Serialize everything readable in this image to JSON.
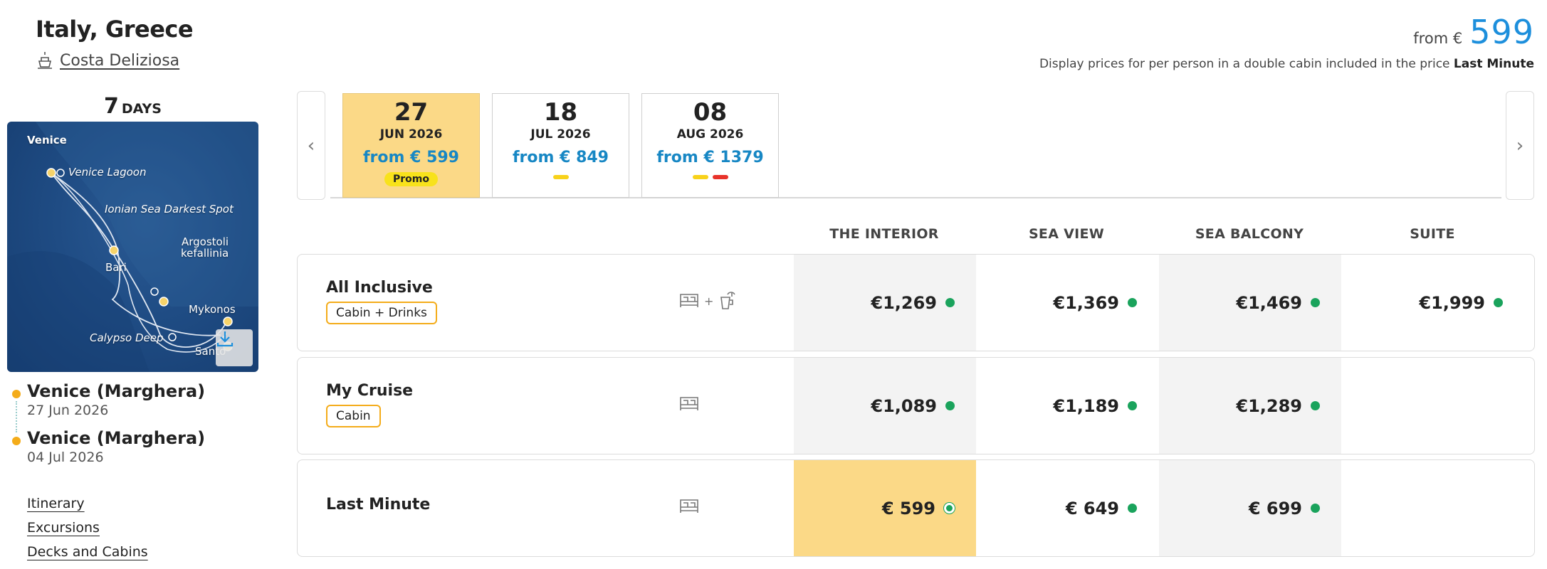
{
  "header": {
    "title": "Italy, Greece",
    "ship": "Costa Deliziosa",
    "from_label": "from €",
    "from_value": "599",
    "disclaimer_text": "Display prices for per person in a double cabin included in the price",
    "disclaimer_bold": "Last Minute"
  },
  "trip": {
    "days_number": "7",
    "days_unit": "DAYS",
    "map_labels": {
      "venice": "Venice",
      "venice_lagoon": "Venice Lagoon",
      "ionian": "Ionian Sea Darkest Spot",
      "argostoli": "Argostoli",
      "kefallinia": "kefallinia",
      "bari": "Bari",
      "mykonos": "Mykonos",
      "calypso": "Calypso Deep",
      "santorini": "Santo"
    },
    "ports": [
      {
        "name": "Venice (Marghera)",
        "date": "27 Jun 2026"
      },
      {
        "name": "Venice (Marghera)",
        "date": "04 Jul 2026"
      }
    ],
    "links": [
      "Itinerary",
      "Excursions",
      "Decks and Cabins"
    ]
  },
  "dates": [
    {
      "day": "27",
      "month": "JUN 2026",
      "price": "from € 599",
      "promo": "Promo",
      "selected": true
    },
    {
      "day": "18",
      "month": "JUL 2026",
      "price": "from € 849",
      "bars": [
        "#f8d21b"
      ]
    },
    {
      "day": "08",
      "month": "AUG 2026",
      "price": "from € 1379",
      "bars": [
        "#f8d21b",
        "#e8332a"
      ]
    }
  ],
  "cabin_headers": [
    "THE INTERIOR",
    "SEA VIEW",
    "SEA BALCONY",
    "SUITE"
  ],
  "fares": [
    {
      "name": "All Inclusive",
      "tag": "Cabin + Drinks",
      "icons": "bed + drinks",
      "plus": "+",
      "prices": [
        "€1,269",
        "€1,369",
        "€1,469",
        "€1,999"
      ]
    },
    {
      "name": "My Cruise",
      "tag": "Cabin",
      "icons": "bed",
      "prices": [
        "€1,089",
        "€1,189",
        "€1,289"
      ]
    },
    {
      "name": "Last Minute",
      "icons": "bed",
      "prices": [
        "€ 599",
        "€ 649",
        "€ 699"
      ]
    }
  ],
  "colors": {
    "accent_blue": "#1d8fdc",
    "price_blue": "#1787c4",
    "highlight": "#fbd987",
    "available_green": "#1aa35c",
    "tag_orange": "#f4ac1a"
  }
}
